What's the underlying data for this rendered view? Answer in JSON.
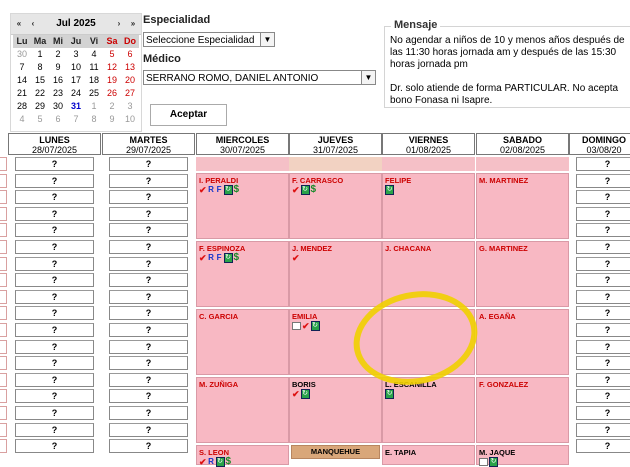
{
  "calendar": {
    "month_label": "Jul 2025",
    "nav": [
      "«",
      "‹",
      "›",
      "»"
    ],
    "weekdays": [
      "Lu",
      "Ma",
      "Mi",
      "Ju",
      "Vi",
      "Sa",
      "Do"
    ],
    "weeks": [
      [
        "30",
        "1",
        "2",
        "3",
        "4",
        "5",
        "6"
      ],
      [
        "7",
        "8",
        "9",
        "10",
        "11",
        "12",
        "13"
      ],
      [
        "14",
        "15",
        "16",
        "17",
        "18",
        "19",
        "20"
      ],
      [
        "21",
        "22",
        "23",
        "24",
        "25",
        "26",
        "27"
      ],
      [
        "28",
        "29",
        "30",
        "31",
        "1",
        "2",
        "3"
      ],
      [
        "4",
        "5",
        "6",
        "7",
        "8",
        "9",
        "10"
      ]
    ],
    "today": "31"
  },
  "form": {
    "especialidad_label": "Especialidad",
    "especialidad_value": "Seleccione Especialidad",
    "medico_label": "Médico",
    "medico_value": "SERRANO ROMO, DANIEL ANTONIO",
    "accept_button": "Aceptar"
  },
  "mensaje": {
    "legend": "Mensaje",
    "line1": "No agendar a niños de 10 y menos años después de las 11:30 horas jornada am y después de las 15:30 horas jornada pm",
    "line2": "Dr. solo atiende de forma PARTICULAR. No acepta bono Fonasa ni Isapre."
  },
  "schedule": {
    "columns": [
      {
        "day": "LUNES",
        "date": "28/07/2025"
      },
      {
        "day": "MARTES",
        "date": "29/07/2025"
      },
      {
        "day": "MIERCOLES",
        "date": "30/07/2025"
      },
      {
        "day": "JUEVES",
        "date": "31/07/2025"
      },
      {
        "day": "VIERNES",
        "date": "01/08/2025"
      },
      {
        "day": "SABADO",
        "date": "02/08/2025"
      },
      {
        "day": "DOMINGO",
        "date": "03/08/20"
      }
    ],
    "empty_marker": "?",
    "appointments": {
      "miercoles": [
        "I. PERALDI",
        "F. ESPINOZA",
        "C. GARCIA",
        "M. ZUÑIGA",
        "S. LEON"
      ],
      "jueves": [
        "F. CARRASCO",
        "J. MENDEZ",
        "EMILIA",
        "BORIS",
        "MANQUEHUE"
      ],
      "viernes": [
        "FELIPE",
        "J. CHACANA",
        "L. ESCANILLA",
        "E. TAPIA"
      ],
      "sabado": [
        "M. MARTINEZ",
        "G. MARTINEZ",
        "A. EGAÑA",
        "F. GONZALEZ",
        "M. JAQUE"
      ]
    },
    "colors": {
      "pink": "#f8b8c3",
      "brown": "#d9a77a",
      "highlight": "#f0d000"
    }
  }
}
